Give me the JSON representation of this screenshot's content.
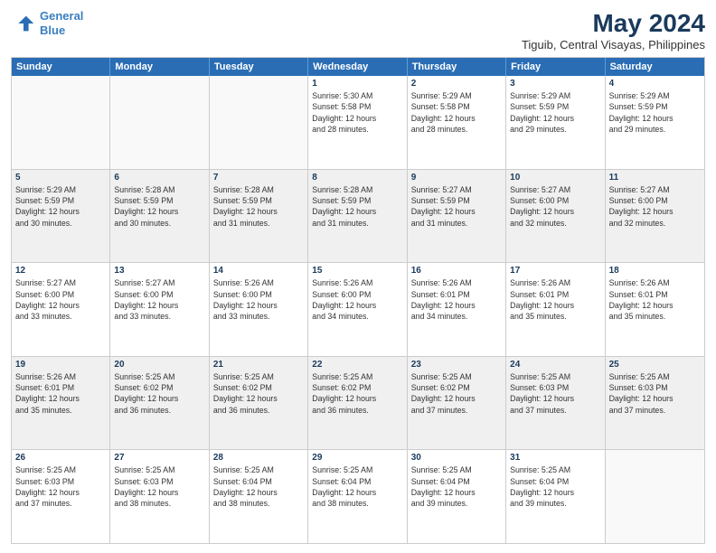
{
  "logo": {
    "line1": "General",
    "line2": "Blue"
  },
  "title": "May 2024",
  "subtitle": "Tiguib, Central Visayas, Philippines",
  "days": [
    "Sunday",
    "Monday",
    "Tuesday",
    "Wednesday",
    "Thursday",
    "Friday",
    "Saturday"
  ],
  "rows": [
    [
      {
        "day": "",
        "info": ""
      },
      {
        "day": "",
        "info": ""
      },
      {
        "day": "",
        "info": ""
      },
      {
        "day": "1",
        "info": "Sunrise: 5:30 AM\nSunset: 5:58 PM\nDaylight: 12 hours\nand 28 minutes."
      },
      {
        "day": "2",
        "info": "Sunrise: 5:29 AM\nSunset: 5:58 PM\nDaylight: 12 hours\nand 28 minutes."
      },
      {
        "day": "3",
        "info": "Sunrise: 5:29 AM\nSunset: 5:59 PM\nDaylight: 12 hours\nand 29 minutes."
      },
      {
        "day": "4",
        "info": "Sunrise: 5:29 AM\nSunset: 5:59 PM\nDaylight: 12 hours\nand 29 minutes."
      }
    ],
    [
      {
        "day": "5",
        "info": "Sunrise: 5:29 AM\nSunset: 5:59 PM\nDaylight: 12 hours\nand 30 minutes."
      },
      {
        "day": "6",
        "info": "Sunrise: 5:28 AM\nSunset: 5:59 PM\nDaylight: 12 hours\nand 30 minutes."
      },
      {
        "day": "7",
        "info": "Sunrise: 5:28 AM\nSunset: 5:59 PM\nDaylight: 12 hours\nand 31 minutes."
      },
      {
        "day": "8",
        "info": "Sunrise: 5:28 AM\nSunset: 5:59 PM\nDaylight: 12 hours\nand 31 minutes."
      },
      {
        "day": "9",
        "info": "Sunrise: 5:27 AM\nSunset: 5:59 PM\nDaylight: 12 hours\nand 31 minutes."
      },
      {
        "day": "10",
        "info": "Sunrise: 5:27 AM\nSunset: 6:00 PM\nDaylight: 12 hours\nand 32 minutes."
      },
      {
        "day": "11",
        "info": "Sunrise: 5:27 AM\nSunset: 6:00 PM\nDaylight: 12 hours\nand 32 minutes."
      }
    ],
    [
      {
        "day": "12",
        "info": "Sunrise: 5:27 AM\nSunset: 6:00 PM\nDaylight: 12 hours\nand 33 minutes."
      },
      {
        "day": "13",
        "info": "Sunrise: 5:27 AM\nSunset: 6:00 PM\nDaylight: 12 hours\nand 33 minutes."
      },
      {
        "day": "14",
        "info": "Sunrise: 5:26 AM\nSunset: 6:00 PM\nDaylight: 12 hours\nand 33 minutes."
      },
      {
        "day": "15",
        "info": "Sunrise: 5:26 AM\nSunset: 6:00 PM\nDaylight: 12 hours\nand 34 minutes."
      },
      {
        "day": "16",
        "info": "Sunrise: 5:26 AM\nSunset: 6:01 PM\nDaylight: 12 hours\nand 34 minutes."
      },
      {
        "day": "17",
        "info": "Sunrise: 5:26 AM\nSunset: 6:01 PM\nDaylight: 12 hours\nand 35 minutes."
      },
      {
        "day": "18",
        "info": "Sunrise: 5:26 AM\nSunset: 6:01 PM\nDaylight: 12 hours\nand 35 minutes."
      }
    ],
    [
      {
        "day": "19",
        "info": "Sunrise: 5:26 AM\nSunset: 6:01 PM\nDaylight: 12 hours\nand 35 minutes."
      },
      {
        "day": "20",
        "info": "Sunrise: 5:25 AM\nSunset: 6:02 PM\nDaylight: 12 hours\nand 36 minutes."
      },
      {
        "day": "21",
        "info": "Sunrise: 5:25 AM\nSunset: 6:02 PM\nDaylight: 12 hours\nand 36 minutes."
      },
      {
        "day": "22",
        "info": "Sunrise: 5:25 AM\nSunset: 6:02 PM\nDaylight: 12 hours\nand 36 minutes."
      },
      {
        "day": "23",
        "info": "Sunrise: 5:25 AM\nSunset: 6:02 PM\nDaylight: 12 hours\nand 37 minutes."
      },
      {
        "day": "24",
        "info": "Sunrise: 5:25 AM\nSunset: 6:03 PM\nDaylight: 12 hours\nand 37 minutes."
      },
      {
        "day": "25",
        "info": "Sunrise: 5:25 AM\nSunset: 6:03 PM\nDaylight: 12 hours\nand 37 minutes."
      }
    ],
    [
      {
        "day": "26",
        "info": "Sunrise: 5:25 AM\nSunset: 6:03 PM\nDaylight: 12 hours\nand 37 minutes."
      },
      {
        "day": "27",
        "info": "Sunrise: 5:25 AM\nSunset: 6:03 PM\nDaylight: 12 hours\nand 38 minutes."
      },
      {
        "day": "28",
        "info": "Sunrise: 5:25 AM\nSunset: 6:04 PM\nDaylight: 12 hours\nand 38 minutes."
      },
      {
        "day": "29",
        "info": "Sunrise: 5:25 AM\nSunset: 6:04 PM\nDaylight: 12 hours\nand 38 minutes."
      },
      {
        "day": "30",
        "info": "Sunrise: 5:25 AM\nSunset: 6:04 PM\nDaylight: 12 hours\nand 39 minutes."
      },
      {
        "day": "31",
        "info": "Sunrise: 5:25 AM\nSunset: 6:04 PM\nDaylight: 12 hours\nand 39 minutes."
      },
      {
        "day": "",
        "info": ""
      }
    ]
  ]
}
